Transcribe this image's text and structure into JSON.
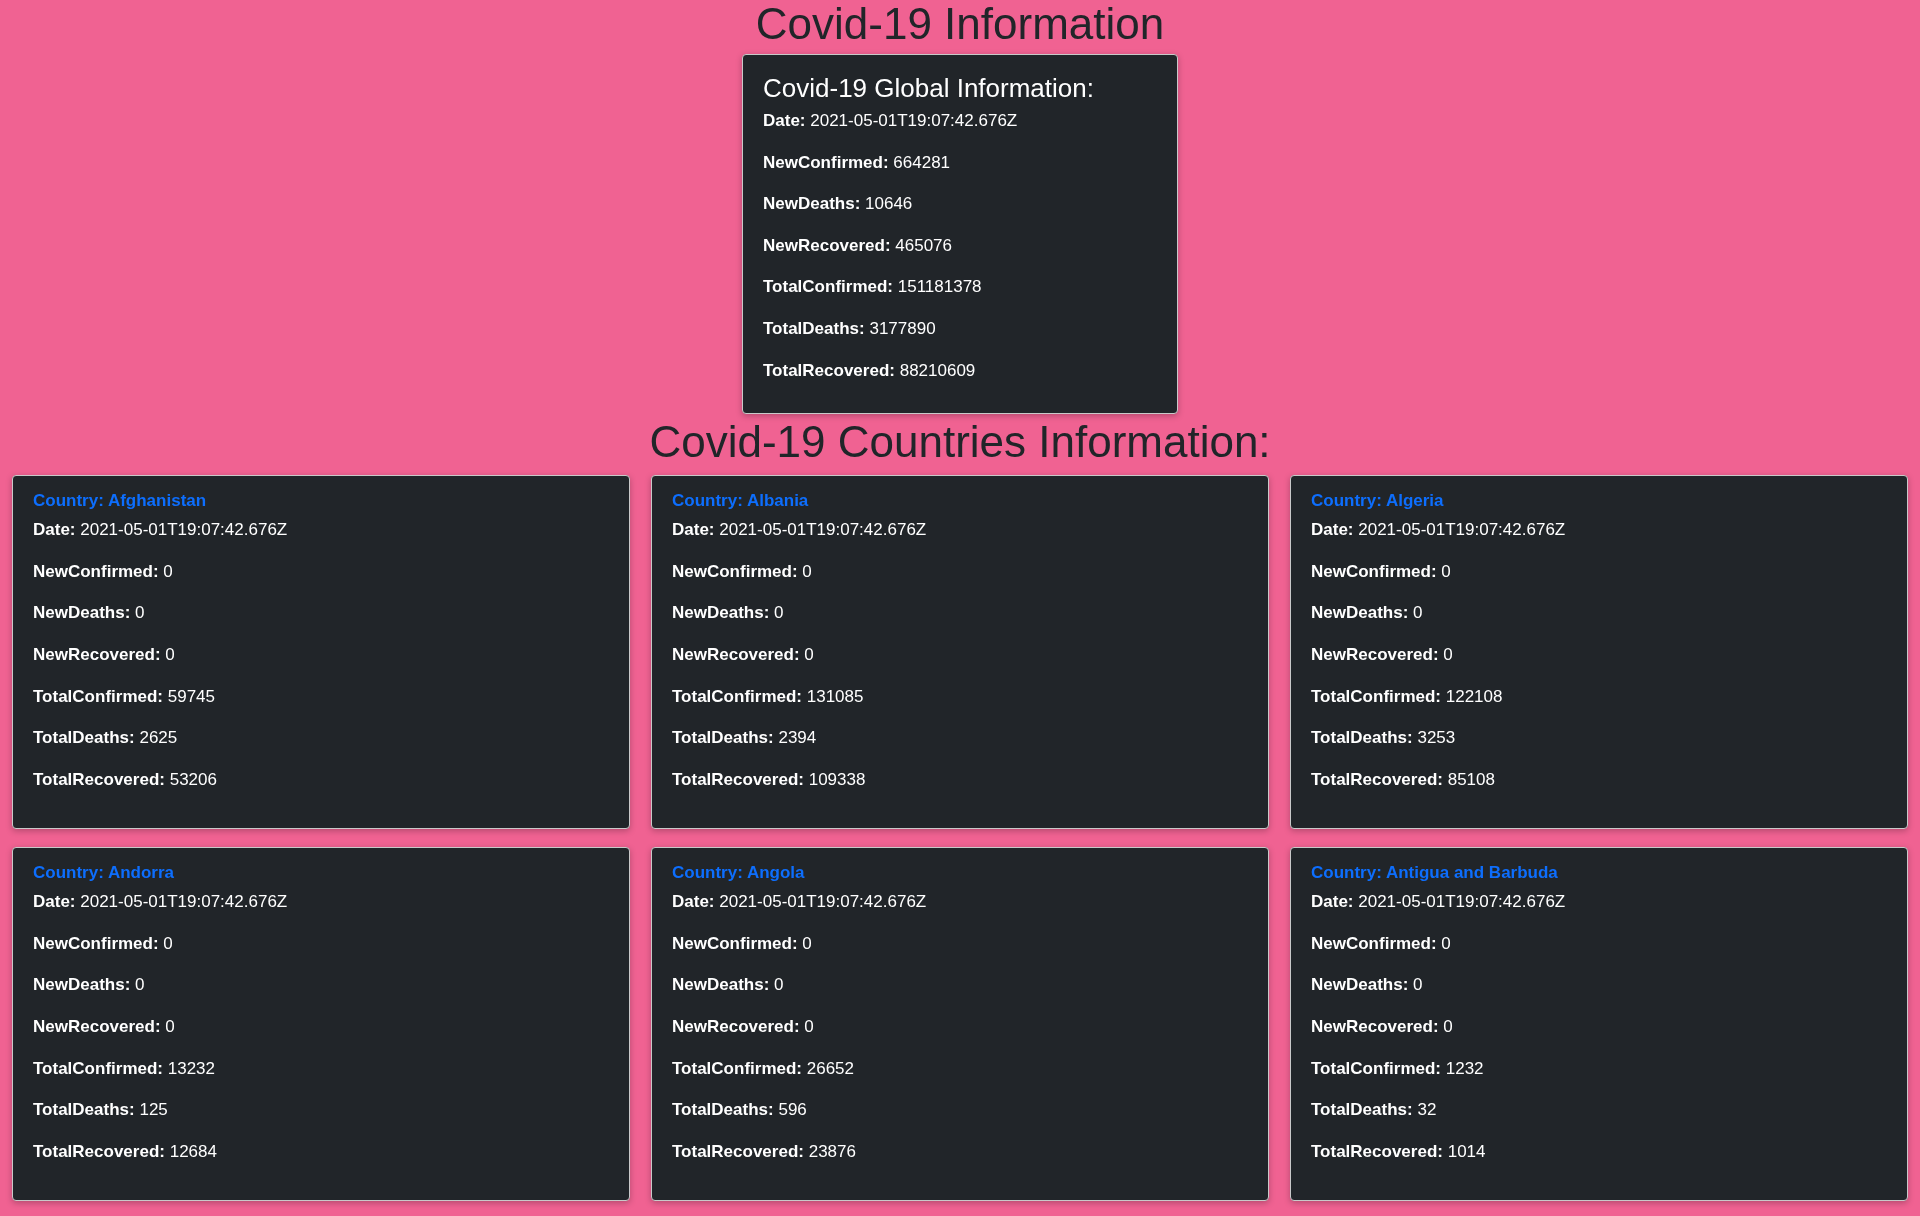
{
  "page_title": "Covid-19 Information",
  "global": {
    "title": "Covid-19 Global Information:",
    "stats": [
      {
        "label": "Date:",
        "value": "2021-05-01T19:07:42.676Z"
      },
      {
        "label": "NewConfirmed:",
        "value": "664281"
      },
      {
        "label": "NewDeaths:",
        "value": "10646"
      },
      {
        "label": "NewRecovered:",
        "value": "465076"
      },
      {
        "label": "TotalConfirmed:",
        "value": "151181378"
      },
      {
        "label": "TotalDeaths:",
        "value": "3177890"
      },
      {
        "label": "TotalRecovered:",
        "value": "88210609"
      }
    ]
  },
  "countries_title": "Covid-19 Countries Information:",
  "countries": [
    {
      "title": "Country: Afghanistan",
      "stats": [
        {
          "label": "Date:",
          "value": "2021-05-01T19:07:42.676Z"
        },
        {
          "label": "NewConfirmed:",
          "value": "0"
        },
        {
          "label": "NewDeaths:",
          "value": "0"
        },
        {
          "label": "NewRecovered:",
          "value": "0"
        },
        {
          "label": "TotalConfirmed:",
          "value": "59745"
        },
        {
          "label": "TotalDeaths:",
          "value": "2625"
        },
        {
          "label": "TotalRecovered:",
          "value": "53206"
        }
      ]
    },
    {
      "title": "Country: Albania",
      "stats": [
        {
          "label": "Date:",
          "value": "2021-05-01T19:07:42.676Z"
        },
        {
          "label": "NewConfirmed:",
          "value": "0"
        },
        {
          "label": "NewDeaths:",
          "value": "0"
        },
        {
          "label": "NewRecovered:",
          "value": "0"
        },
        {
          "label": "TotalConfirmed:",
          "value": "131085"
        },
        {
          "label": "TotalDeaths:",
          "value": "2394"
        },
        {
          "label": "TotalRecovered:",
          "value": "109338"
        }
      ]
    },
    {
      "title": "Country: Algeria",
      "stats": [
        {
          "label": "Date:",
          "value": "2021-05-01T19:07:42.676Z"
        },
        {
          "label": "NewConfirmed:",
          "value": "0"
        },
        {
          "label": "NewDeaths:",
          "value": "0"
        },
        {
          "label": "NewRecovered:",
          "value": "0"
        },
        {
          "label": "TotalConfirmed:",
          "value": "122108"
        },
        {
          "label": "TotalDeaths:",
          "value": "3253"
        },
        {
          "label": "TotalRecovered:",
          "value": "85108"
        }
      ]
    },
    {
      "title": "Country: Andorra",
      "stats": [
        {
          "label": "Date:",
          "value": "2021-05-01T19:07:42.676Z"
        },
        {
          "label": "NewConfirmed:",
          "value": "0"
        },
        {
          "label": "NewDeaths:",
          "value": "0"
        },
        {
          "label": "NewRecovered:",
          "value": "0"
        },
        {
          "label": "TotalConfirmed:",
          "value": "13232"
        },
        {
          "label": "TotalDeaths:",
          "value": "125"
        },
        {
          "label": "TotalRecovered:",
          "value": "12684"
        }
      ]
    },
    {
      "title": "Country: Angola",
      "stats": [
        {
          "label": "Date:",
          "value": "2021-05-01T19:07:42.676Z"
        },
        {
          "label": "NewConfirmed:",
          "value": "0"
        },
        {
          "label": "NewDeaths:",
          "value": "0"
        },
        {
          "label": "NewRecovered:",
          "value": "0"
        },
        {
          "label": "TotalConfirmed:",
          "value": "26652"
        },
        {
          "label": "TotalDeaths:",
          "value": "596"
        },
        {
          "label": "TotalRecovered:",
          "value": "23876"
        }
      ]
    },
    {
      "title": "Country: Antigua and Barbuda",
      "stats": [
        {
          "label": "Date:",
          "value": "2021-05-01T19:07:42.676Z"
        },
        {
          "label": "NewConfirmed:",
          "value": "0"
        },
        {
          "label": "NewDeaths:",
          "value": "0"
        },
        {
          "label": "NewRecovered:",
          "value": "0"
        },
        {
          "label": "TotalConfirmed:",
          "value": "1232"
        },
        {
          "label": "TotalDeaths:",
          "value": "32"
        },
        {
          "label": "TotalRecovered:",
          "value": "1014"
        }
      ]
    }
  ]
}
